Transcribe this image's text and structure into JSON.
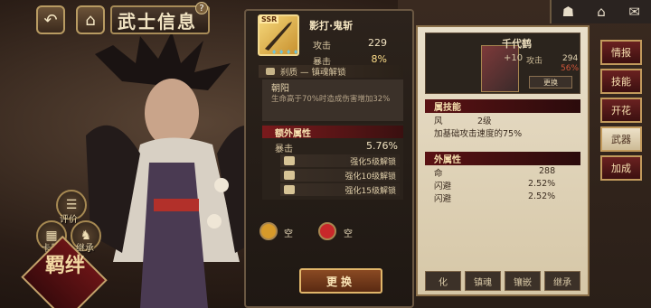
{
  "header": {
    "back_icon": "back-arrow-icon",
    "home_icon": "home-icon",
    "title": "武士信息",
    "help": "?",
    "top_right_icons": [
      "character-icon",
      "home-icon",
      "mail-icon"
    ]
  },
  "left_actions": [
    {
      "label": "评价"
    },
    {
      "label": "卡册"
    },
    {
      "label": "继承"
    }
  ],
  "kizuna": {
    "label": "羁绊"
  },
  "weapon": {
    "rarity": "SSR",
    "name": "影打·鬼斩",
    "stats": [
      {
        "label": "攻击",
        "value": "229"
      },
      {
        "label": "暴击",
        "value": "8%"
      }
    ],
    "skill_bar": "刹质 — 镇魂解锁",
    "skill_name": "朝阳",
    "skill_desc": "生命高于70%时造成伤害增加32%",
    "extra_title": "额外属性",
    "extra_stat": {
      "label": "暴击",
      "value": "5.76%"
    },
    "locks": [
      {
        "text": "强化5级解锁"
      },
      {
        "text": "强化10级解锁"
      },
      {
        "text": "强化15级解锁"
      }
    ],
    "slots": [
      {
        "label": "空",
        "color": "#d79a2a"
      },
      {
        "label": "空",
        "color": "#c8282a"
      }
    ],
    "change_button": "更换"
  },
  "right_panel": {
    "name": "千代鹤",
    "level": "+10",
    "stat1_label": "攻击",
    "stat1_value": "294",
    "stat2_value": "56%",
    "change_button": "更换",
    "skill_section": "属技能",
    "skill_row_left": "风",
    "skill_row_right": "2级",
    "skill_desc": "加基础攻击速度的75%",
    "extra_section": "外属性",
    "extra_rows": [
      {
        "label": "命",
        "value": "288"
      },
      {
        "label": "闪避",
        "value": "2.52%"
      },
      {
        "label": "闪避",
        "value": "2.52%"
      }
    ],
    "tabs": [
      "化",
      "镇魂",
      "镶嵌",
      "继承"
    ]
  },
  "side_tabs": [
    {
      "label": "情报",
      "active": false
    },
    {
      "label": "技能",
      "active": false
    },
    {
      "label": "开花",
      "active": false
    },
    {
      "label": "武器",
      "active": true
    },
    {
      "label": "加成",
      "active": false
    }
  ]
}
